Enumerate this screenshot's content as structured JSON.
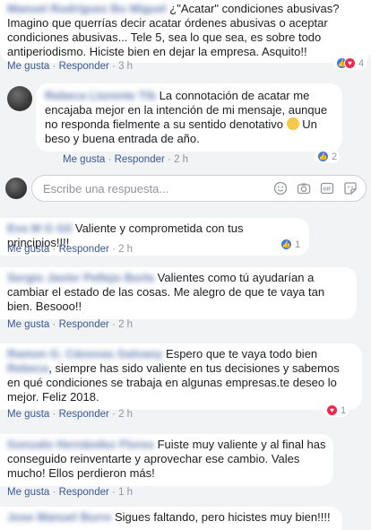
{
  "comments": [
    {
      "author": "Manuel Rodríguez Bo Miguel",
      "text": "¿\"Acatar\" condiciones abusivas? Imagino que querrías decir acatar órdenes abusivas o aceptar condiciones abusivas... Tele 5, sea lo que sea, es sobre todo antiperiodismo. Hiciste bien en dejar la empresa. Asquito!!",
      "like": "Me gusta",
      "reply": "Responder",
      "time": "3 h",
      "reactions": "4"
    },
    {
      "author": "Rebeca Llorente Tib",
      "text": "La connotación de acatar me encajaba mejor en la intención de mi mensaje, aunque no responda fielmente a su sentido denotativo",
      "text_after": "Un beso y buena entrada de año.",
      "like": "Me gusta",
      "reply": "Responder",
      "time": "2 h",
      "reactions": "2"
    },
    {
      "author": "Eva M G Gil",
      "text": "Valiente y comprometida con tus principios!!!!",
      "like": "Me gusta",
      "reply": "Responder",
      "time": "2 h",
      "reactions": "1"
    },
    {
      "author": "Sergio Javier Pellejo Borla",
      "text": "Valientes como tú ayudarían a cambiar el estado de las cosas. Me alegro de que te vaya tan bien. Besooo!!",
      "like": "Me gusta",
      "reply": "Responder",
      "time": "2 h"
    },
    {
      "author": "Ramon G. Cánovas Galvany",
      "author2": "Rebeca",
      "text": "Espero que te vaya todo bien",
      "text_after": ", siempre has sido valiente en tus decisiones y sabemos en qué condiciones se trabaja en algunas empresas.te deseo lo mejor. Feliz 2018.",
      "like": "Me gusta",
      "reply": "Responder",
      "time": "2 h",
      "reactions": "1"
    },
    {
      "author": "Gonzalo Hernández Flores",
      "text": "Fuiste muy valiente y al final has conseguido reinventarte y aprovechar ese cambio. Vales mucho! Ellos perdieron más!",
      "like": "Me gusta",
      "reply": "Responder",
      "time": "1 h"
    },
    {
      "author": "Jose Manuel Burre",
      "text": "Sigues faltando, pero hicistes muy bien!!!!"
    }
  ],
  "reply_box": {
    "placeholder": "Escribe una respuesta..."
  },
  "icons": {
    "like": "like-icon",
    "love": "love-icon",
    "emoji": "smiley-icon",
    "camera": "camera-icon",
    "gif": "gif-icon",
    "sticker": "sticker-icon"
  },
  "colors": {
    "link": "#385898",
    "like": "#3b78e7",
    "love": "#f0284a"
  }
}
